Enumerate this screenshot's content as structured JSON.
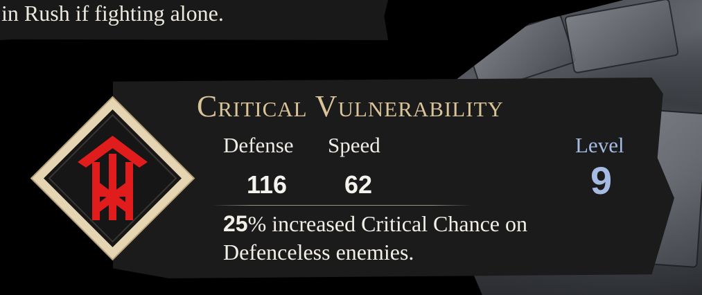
{
  "top_text": "in Rush if fighting alone.",
  "ability": {
    "title": "Critical Vulnerability",
    "icon": "rune-tower-icon",
    "stats": [
      {
        "label": "Defense",
        "value": "116"
      },
      {
        "label": "Speed",
        "value": "62"
      }
    ],
    "level_label": "Level",
    "level_value": "9",
    "description_value": "25",
    "description_text": "% increased Critical Chance on Defenceless enemies."
  },
  "colors": {
    "title": "#d9c49a",
    "level": "#a6bbe4",
    "icon": "#e11c1c",
    "frame": "#e6d5b3"
  }
}
